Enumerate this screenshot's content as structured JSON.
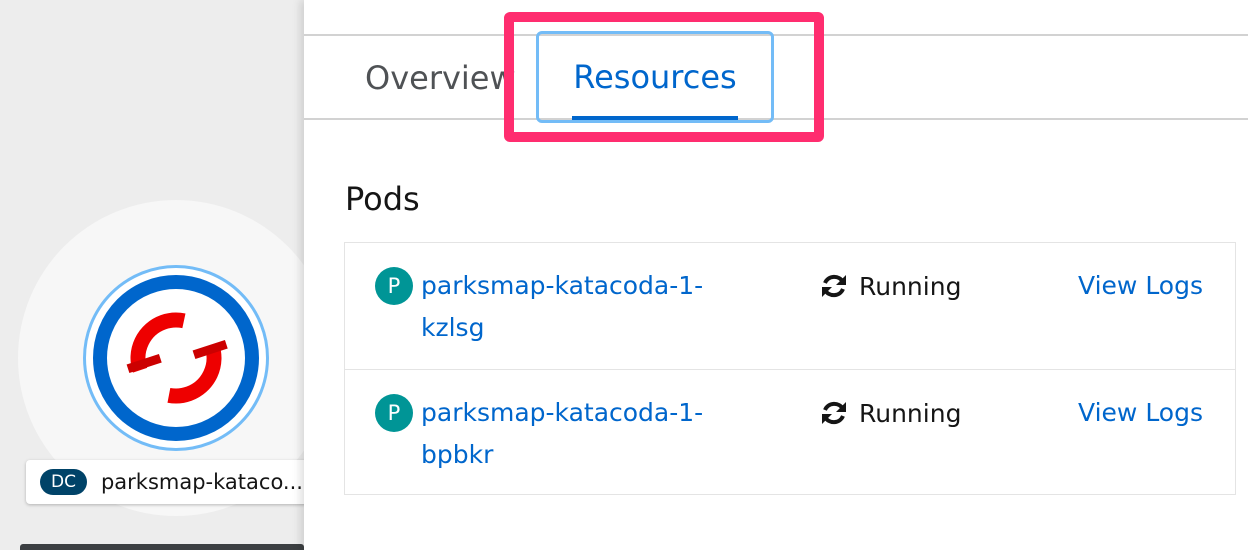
{
  "topology": {
    "node": {
      "kind_badge": "DC",
      "name": "parksmap-kataco...",
      "icon": "openshift-logo-icon"
    }
  },
  "tabs": [
    {
      "label": "Overview",
      "active": false
    },
    {
      "label": "Resources",
      "active": true
    }
  ],
  "pods_section": {
    "title": "Pods",
    "items": [
      {
        "badge": "P",
        "name": "parksmap-katacoda-1-kzlsg",
        "status": "Running",
        "status_icon": "sync-icon",
        "action": "View Logs"
      },
      {
        "badge": "P",
        "name": "parksmap-katacoda-1-bpbkr",
        "status": "Running",
        "status_icon": "sync-icon",
        "action": "View Logs"
      }
    ]
  },
  "colors": {
    "link": "#0066cc",
    "highlight": "#ff2d6f",
    "focus_ring": "#73bcf7",
    "pod_badge": "#009596",
    "dc_badge": "#004368"
  }
}
